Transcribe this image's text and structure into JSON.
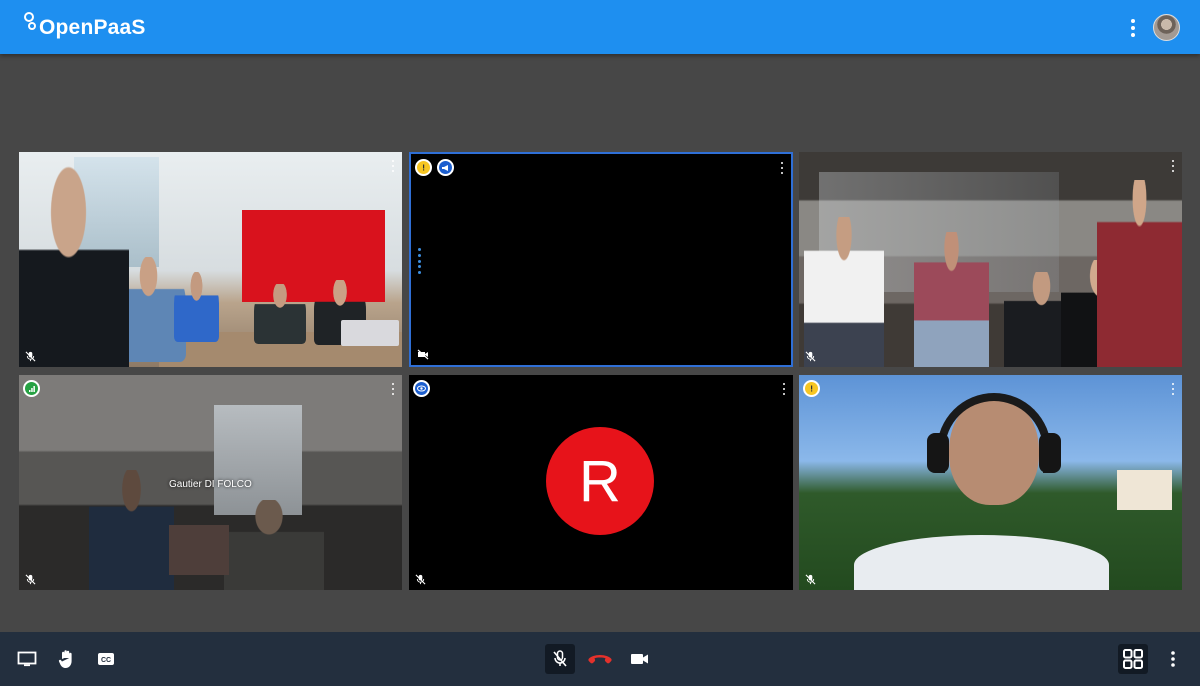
{
  "app": {
    "logo_text": "OpenPaaS"
  },
  "header": {
    "menu_icon": "more-vert-icon",
    "avatar_icon": "user-avatar"
  },
  "participants": [
    {
      "id": "room-1",
      "name": "",
      "muted": true,
      "badges": []
    },
    {
      "id": "remote-2",
      "name": "",
      "muted": false,
      "video_off": true,
      "active_speaker": true,
      "badges": [
        "warning-badge",
        "megaphone-badge"
      ]
    },
    {
      "id": "room-3",
      "name": "",
      "muted": true,
      "badges": []
    },
    {
      "id": "room-4",
      "name": "Gautier DI FOLCO",
      "muted": true,
      "badges": [
        "connection-badge"
      ]
    },
    {
      "id": "remote-5",
      "name": "",
      "initial": "R",
      "muted": true,
      "badges": [
        "presenter-badge"
      ]
    },
    {
      "id": "remote-6",
      "name": "",
      "muted": true,
      "badges": [
        "warning-badge"
      ]
    }
  ],
  "toolbar": {
    "left": [
      "screen-share-icon",
      "raise-hand-icon",
      "closed-captions-icon"
    ],
    "center": [
      "mic-muted-icon",
      "hang-up-icon",
      "camera-icon"
    ],
    "right": [
      "tile-view-icon",
      "more-vert-icon"
    ]
  },
  "colors": {
    "header": "#1e8ff0",
    "toolbar": "#232f3e",
    "stage": "#474747",
    "hangup": "#e4312b",
    "active_border": "#2f6fd6",
    "avatar_red": "#e7131a"
  }
}
